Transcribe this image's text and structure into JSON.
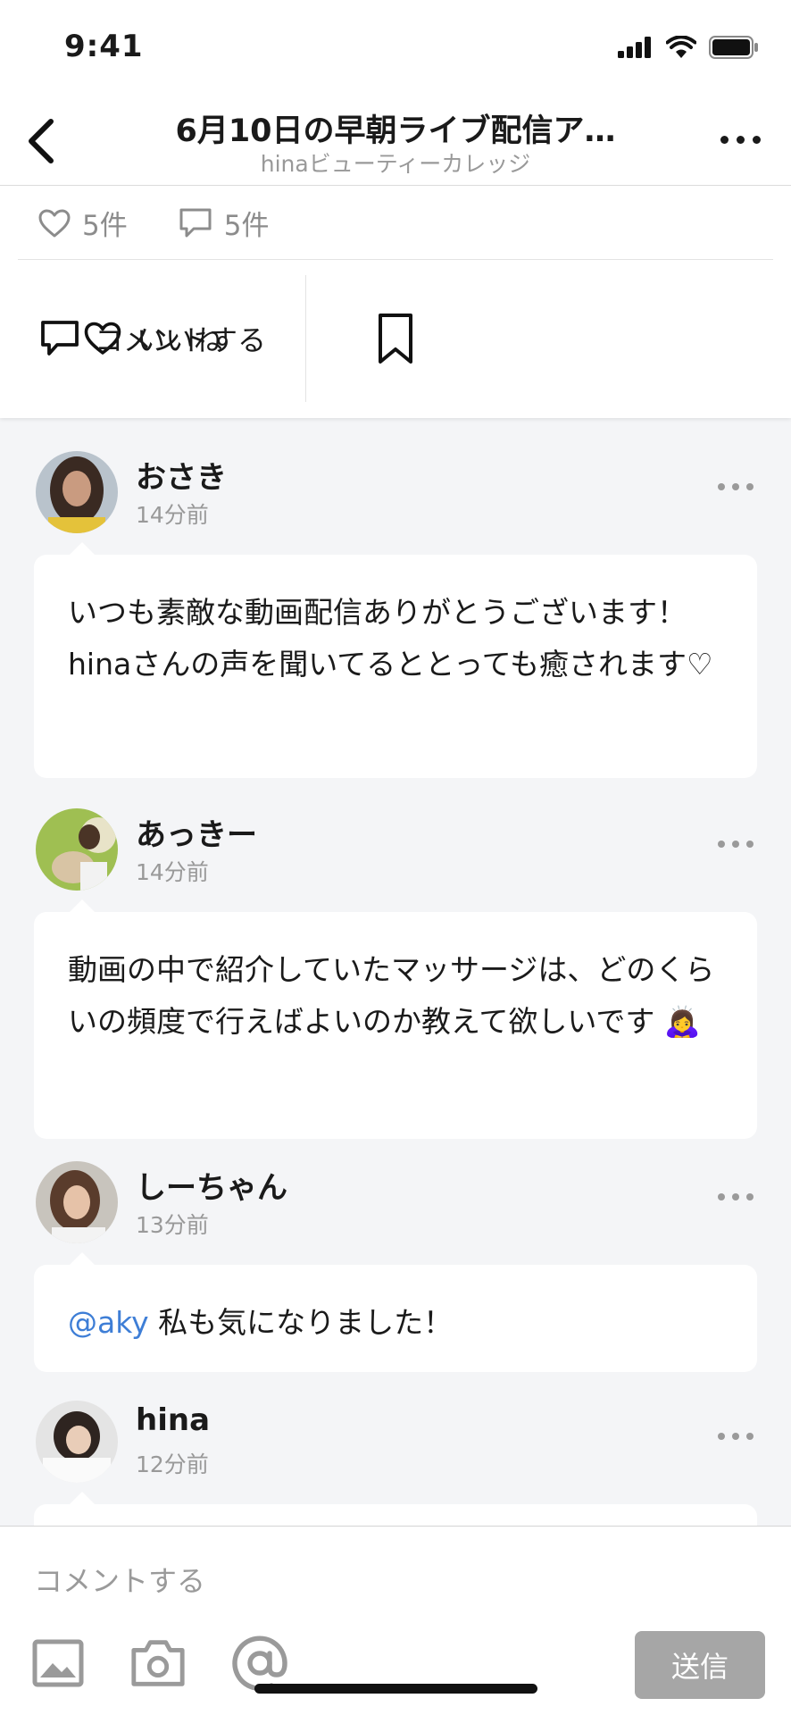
{
  "status": {
    "time": "9:41"
  },
  "nav": {
    "title": "6月10日の早朝ライブ配信ア…",
    "subtitle": "hinaビューティーカレッジ"
  },
  "counts": {
    "likes": "5件",
    "comments": "5件"
  },
  "actions": {
    "like_label": "いいね",
    "comment_label": "コメントする"
  },
  "comments": [
    {
      "name": "おさき",
      "time": "14分前",
      "text": "いつも素敵な動画配信ありがとうございます！hinaさんの声を聞いてるととっても癒されます♡"
    },
    {
      "name": "あっきー",
      "time": "14分前",
      "text": "動画の中で紹介していたマッサージは、どのくらいの頻度で行えばよいのか教えて欲しいです",
      "emoji": "🙇‍♀️"
    },
    {
      "name": "しーちゃん",
      "time": "13分前",
      "mention": "@aky",
      "text": " 私も気になりました！"
    },
    {
      "name": "hina",
      "time": "12分前"
    }
  ],
  "composer": {
    "placeholder": "コメントする",
    "send_label": "送信"
  },
  "colors": {
    "mention": "#3e7ed6",
    "send_button": "#a6a6a6",
    "background": "#f4f5f7"
  }
}
